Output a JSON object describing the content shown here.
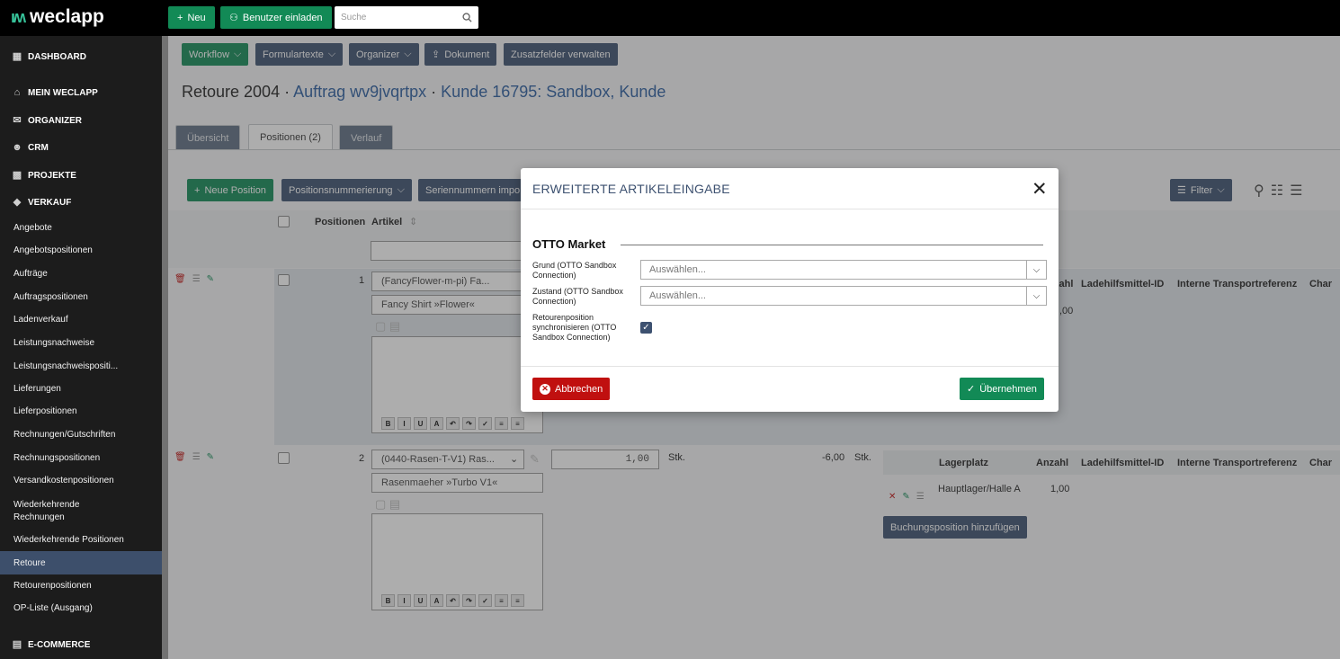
{
  "topbar": {
    "logo": "weclapp",
    "new_label": "Neu",
    "invite_label": "Benutzer einladen",
    "search_placeholder": "Suche"
  },
  "sidebar": {
    "main_items": [
      {
        "label": "DASHBOARD",
        "icon": "dashboard-icon"
      },
      {
        "label": "MEIN WECLAPP",
        "icon": "home-icon"
      },
      {
        "label": "ORGANIZER",
        "icon": "mail-icon"
      },
      {
        "label": "CRM",
        "icon": "people-icon"
      },
      {
        "label": "PROJEKTE",
        "icon": "briefcase-icon"
      },
      {
        "label": "VERKAUF",
        "icon": "tag-icon"
      },
      {
        "label": "E-COMMERCE",
        "icon": "store-icon"
      }
    ],
    "sub_items": [
      "Angebote",
      "Angebotspositionen",
      "Aufträge",
      "Auftragspositionen",
      "Ladenverkauf",
      "Leistungsnachweise",
      "Leistungsnachweispositi...",
      "Lieferungen",
      "Lieferpositionen",
      "Rechnungen/Gutschriften",
      "Rechnungspositionen",
      "Versandkostenpositionen",
      "Wiederkehrende Rechnungen",
      "Wiederkehrende Positionen",
      "Retoure",
      "Retourenpositionen",
      "OP-Liste (Ausgang)"
    ],
    "active": "Retoure"
  },
  "toolbar": {
    "workflow": "Workflow",
    "formulartexte": "Formulartexte",
    "organizer": "Organizer",
    "dokument": "Dokument",
    "zusatzfelder": "Zusatzfelder verwalten"
  },
  "title": {
    "main": "Retoure 2004",
    "sep": " · ",
    "order": "Auftrag wv9jvqrtpx",
    "customer": "Kunde 16795: Sandbox, Kunde"
  },
  "tabs": [
    {
      "label": "Übersicht",
      "active": false
    },
    {
      "label": "Positionen (2)",
      "active": true
    },
    {
      "label": "Verlauf",
      "active": false
    }
  ],
  "positions_toolbar": {
    "new_position": "Neue Position",
    "numbering": "Positionsnummerierung",
    "serial_import": "Seriennummern impo",
    "filter": "Filter"
  },
  "table": {
    "col_positions": "Positionen",
    "col_article": "Artikel",
    "rows": [
      {
        "number": "1",
        "article_select": "(FancyFlower-m-pi) Fa...",
        "article_name": "Fancy Shirt »Flower«",
        "stock_headers": [
          "zahl",
          "Ladehilfsmittel-ID",
          "Interne Transportreferenz",
          "Char"
        ],
        "stock_amount": ",00"
      },
      {
        "number": "2",
        "article_select": "(0440-Rasen-T-V1) Ras...",
        "article_name": "Rasenmaeher »Turbo V1«",
        "quantity": "1,00",
        "unit": "Stk.",
        "price": "-6,00",
        "price_unit": "Stk.",
        "stock_headers": [
          "Lagerplatz",
          "Anzahl",
          "Ladehilfsmittel-ID",
          "Interne Transportreferenz",
          "Char"
        ],
        "stock_place": "Hauptlager/Halle A",
        "stock_amount": "1,00",
        "add_booking": "Buchungsposition hinzufügen"
      }
    ]
  },
  "modal": {
    "title": "ERWEITERTE ARTIKELEINGABE",
    "section": "OTTO Market",
    "field_reason_label": "Grund (OTTO Sandbox Connection)",
    "field_reason_placeholder": "Auswählen...",
    "field_state_label": "Zustand (OTTO Sandbox Connection)",
    "field_state_placeholder": "Auswählen...",
    "field_sync_label": "Retourenposition synchronisieren (OTTO Sandbox Connection)",
    "field_sync_checked": true,
    "cancel": "Abbrechen",
    "apply": "Übernehmen"
  },
  "colors": {
    "accent_green": "#128a56",
    "accent_blue": "#3d5170",
    "danger_red": "#c0100f"
  }
}
